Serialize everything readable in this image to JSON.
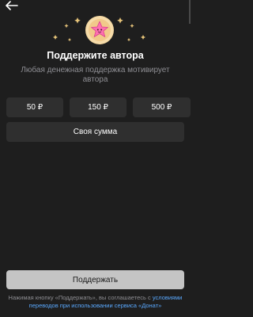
{
  "header": {
    "back_icon": "arrow-left-icon"
  },
  "hero": {
    "badge_icon": "star-donut-icon",
    "decor_icon": "sparkle-star-icon"
  },
  "title": "Поддержите автора",
  "subtitle": "Любая денежная поддержка мотивирует автора",
  "amounts": [
    {
      "label": "50 ₽"
    },
    {
      "label": "150 ₽"
    },
    {
      "label": "500 ₽"
    }
  ],
  "own_sum_label": "Своя сумма",
  "support_button_label": "Поддержать",
  "legal": {
    "prefix": "Нажимая кнопку «Поддержать», вы соглашаетесь с ",
    "link_text": "условиями переводов при использовании сервиса «Донат»"
  },
  "colors": {
    "background": "#1e1e1e",
    "button_bg": "#2f2f2f",
    "support_bg": "#c4c4c4",
    "link": "#5aa9ff",
    "muted_text": "#8e8e93",
    "star": "#e8c57a"
  }
}
